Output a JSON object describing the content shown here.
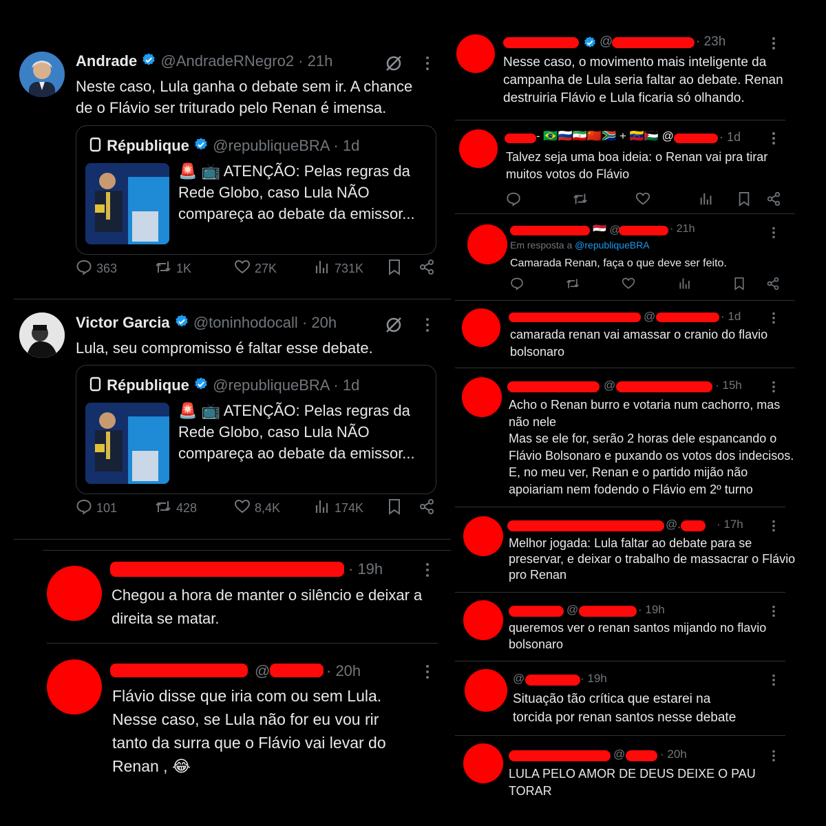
{
  "andrade": {
    "name": "Andrade",
    "handle": "@AndradeRNegro2",
    "time": "· 21h",
    "text_line1": "Neste caso, Lula ganha o debate sem ir. A chance",
    "text_line2": "de o Flávio ser triturado pelo Renan é imensa.",
    "quote": {
      "name": "République",
      "handle": "@republiqueBRA",
      "time": "· 1d",
      "line1": "🚨 📺 ATENÇÃO: Pelas regras da",
      "line2": "Rede Globo, caso Lula NÃO",
      "line3": "compareça ao debate da emissor..."
    },
    "stats": {
      "replies": "363",
      "reposts": "1K",
      "likes": "27K",
      "views": "731K"
    }
  },
  "victor": {
    "name": "Victor Garcia",
    "handle": "@toninhodocall",
    "time": "· 20h",
    "text_line1": "Lula, seu compromisso é faltar esse debate.",
    "quote": {
      "name": "République",
      "handle": "@republiqueBRA",
      "time": "· 1d",
      "line1": "🚨 📺 ATENÇÃO: Pelas regras da",
      "line2": "Rede Globo, caso Lula NÃO",
      "line3": "compareça ao debate da emissor..."
    },
    "stats": {
      "replies": "101",
      "reposts": "428",
      "likes": "8,4K",
      "views": "174K"
    }
  },
  "bottom_left": [
    {
      "time": "· 19h",
      "line1": "Chegou a hora de manter o silêncio e deixar a",
      "line2": "direita se matar."
    },
    {
      "at": "@",
      "time": "· 20h",
      "line1": "Flávio disse que iria com ou sem Lula.",
      "line2": "Nesse caso, se Lula não for eu vou rir",
      "line3": "tanto da surra que o Flávio vai levar do",
      "line4": "Renan , 😂"
    }
  ],
  "right": [
    {
      "at": "@",
      "time": "· 23h",
      "lines": [
        "Nesse caso, o movimento mais inteligente da",
        "campanha de Lula seria faltar ao debate. Renan",
        "destruiria Flávio e Lula ficaria só olhando."
      ]
    },
    {
      "flags": "- 🇧🇷🇷🇺🇮🇷🇨🇳🇿🇦 + 🇻🇪🇵🇸 @",
      "time": "· 1d",
      "lines": [
        "Talvez seja uma boa ideia: o Renan vai pra tirar",
        "muitos votos do Flávio"
      ]
    },
    {
      "at": "🇪🇬 @",
      "time": "· 21h",
      "reply_prefix": "Em resposta a ",
      "reply_to": "@republiqueBRA",
      "lines": [
        "Camarada Renan, faça o que deve ser feito."
      ]
    },
    {
      "at": "@",
      "time": "· 1d",
      "lines": [
        "camarada renan vai amassar o cranio do flavio",
        "bolsonaro"
      ]
    },
    {
      "at": "@",
      "time": "· 15h",
      "lines": [
        "Acho o Renan burro e votaria num cachorro, mas",
        "não nele",
        "Mas se ele for, serão 2 horas dele espancando o",
        "Flávio Bolsonaro e puxando os votos dos indecisos.",
        "E, no meu ver, Renan e o partido mijão não",
        "apoiariam nem fodendo o Flávio em 2º turno"
      ]
    },
    {
      "at": "@.",
      "time": "· 17h",
      "lines": [
        "Melhor jogada: Lula faltar ao debate para se",
        "preservar, e deixar o trabalho de massacrar o Flávio",
        "pro Renan"
      ]
    },
    {
      "at": "@",
      "time": "· 19h",
      "lines": [
        "queremos ver o renan santos mijando no flavio",
        "bolsonaro"
      ]
    },
    {
      "at": "@",
      "time": "· 19h",
      "lines": [
        "Situação tão crítica que estarei na",
        "torcida por renan santos nesse debate"
      ]
    },
    {
      "at": "@",
      "time": "· 20h",
      "lines": [
        "LULA PELO AMOR DE DEUS DEIXE O PAU",
        "TORAR"
      ]
    }
  ],
  "colors": {
    "redaction": "#ff0000",
    "verified": "#1d9bf0",
    "muted": "#71767b",
    "link": "#1d9bf0"
  }
}
